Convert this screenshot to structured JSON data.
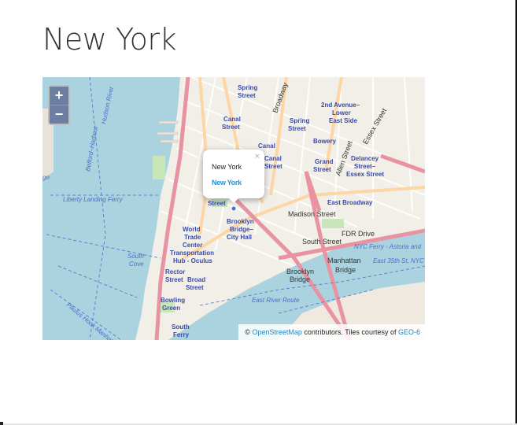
{
  "page": {
    "title": "New York"
  },
  "map": {
    "zoom_in_label": "+",
    "zoom_out_label": "−",
    "popup": {
      "title": "New York",
      "link_text": "New York",
      "close_label": "×"
    },
    "attribution": {
      "prefix": "©",
      "osm_link": "OpenStreetMap",
      "middle": "contributors. Tiles courtesy of",
      "tile_link": "GEO-6"
    },
    "labels": {
      "spring_street_top": "Spring",
      "street_word": "Street",
      "canal_street": "Canal",
      "second_avenue": "2nd Avenue–",
      "lower_east_side": "Lower",
      "east_side": "East Side",
      "bowery": "Bowery",
      "delancey": "Delancey",
      "essex": "Street–",
      "essex_street": "Essex Street",
      "grand": "Grand",
      "east_broadway": "East Broadway",
      "madison_street": "Madison Street",
      "brooklyn_bridge_city_hall_1": "Brooklyn",
      "brooklyn_bridge_city_hall_2": "Bridge–",
      "brooklyn_bridge_city_hall_3": "City Hall",
      "world_trade_1": "World",
      "world_trade_2": "Trade",
      "world_trade_3": "Center",
      "world_trade_4": "Transportation",
      "world_trade_5": "Hub - Oculus",
      "rector": "Rector",
      "broad": "Broad",
      "bowling_green_1": "Bowling",
      "bowling_green_2": "Green",
      "south_ferry_1": "South",
      "south_ferry_2": "Ferry",
      "manhattan_bridge_1": "Manhattan",
      "manhattan_bridge_2": "Bridge",
      "brooklyn_bridge_1": "Brooklyn",
      "brooklyn_bridge_2": "Bridge",
      "liberty_landing_ferry": "Liberty Landing Ferry",
      "fdr_drive": "FDR Drive",
      "south_street": "South Street",
      "nyc_ferry": "NYC Ferry - Astoria and",
      "east_35th": "East 35th St, NYC",
      "east_river_route": "East River Route",
      "paulus_hook": "Paulus Hook Manhattan",
      "south_cove_1": "South",
      "south_cove_2": "Cove",
      "hudson_river": "Hudson River",
      "belford": "Belford–Harbour",
      "broadway": "Broadway",
      "essex_street_road": "Essex Street",
      "allen_street": "Allen Street",
      "ge": "ge"
    },
    "colors": {
      "water": "#aad3df",
      "land": "#f2efe9",
      "major_road": "#e892a2",
      "secondary_road": "#fcd6a4",
      "transit": "#4b6fc7"
    }
  }
}
